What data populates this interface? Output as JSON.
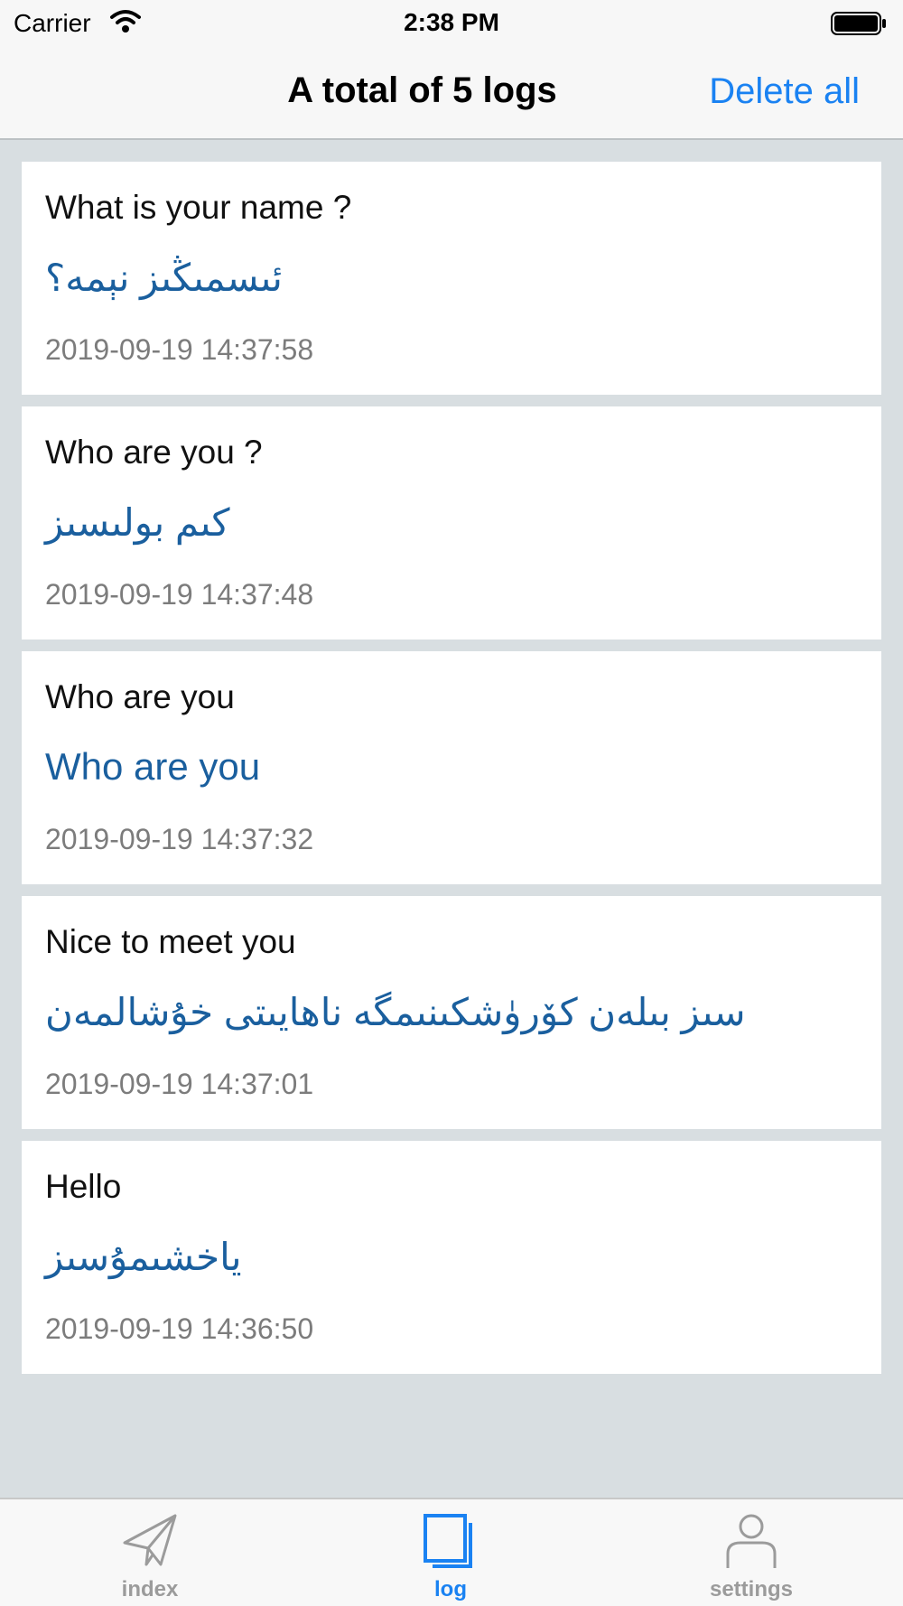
{
  "status_bar": {
    "carrier": "Carrier",
    "time": "2:38 PM"
  },
  "nav": {
    "title": "A total of 5 logs",
    "action": "Delete all"
  },
  "logs": [
    {
      "source": "What is your name ?",
      "target": "ئىسمىڭىز نېمە؟",
      "time": "2019-09-19 14:37:58"
    },
    {
      "source": "Who are you ?",
      "target": "كىم بولىسىز",
      "time": "2019-09-19 14:37:48"
    },
    {
      "source": "Who are you",
      "target": "Who are you",
      "time": "2019-09-19 14:37:32"
    },
    {
      "source": "Nice to meet you",
      "target": "سىز بىلەن كۆرۈشكىنىمگە ناھايىتى خۇشالمەن",
      "time": "2019-09-19 14:37:01"
    },
    {
      "source": "Hello",
      "target": "ياخشىمۇسىز",
      "time": "2019-09-19 14:36:50"
    }
  ],
  "tabs": [
    {
      "label": "index",
      "icon": "paper-plane-icon",
      "active": false
    },
    {
      "label": "log",
      "icon": "documents-icon",
      "active": true
    },
    {
      "label": "settings",
      "icon": "person-icon",
      "active": false
    }
  ],
  "colors": {
    "accent": "#1a82f2",
    "target_text": "#1a5f9e",
    "background": "#d8dee1"
  }
}
